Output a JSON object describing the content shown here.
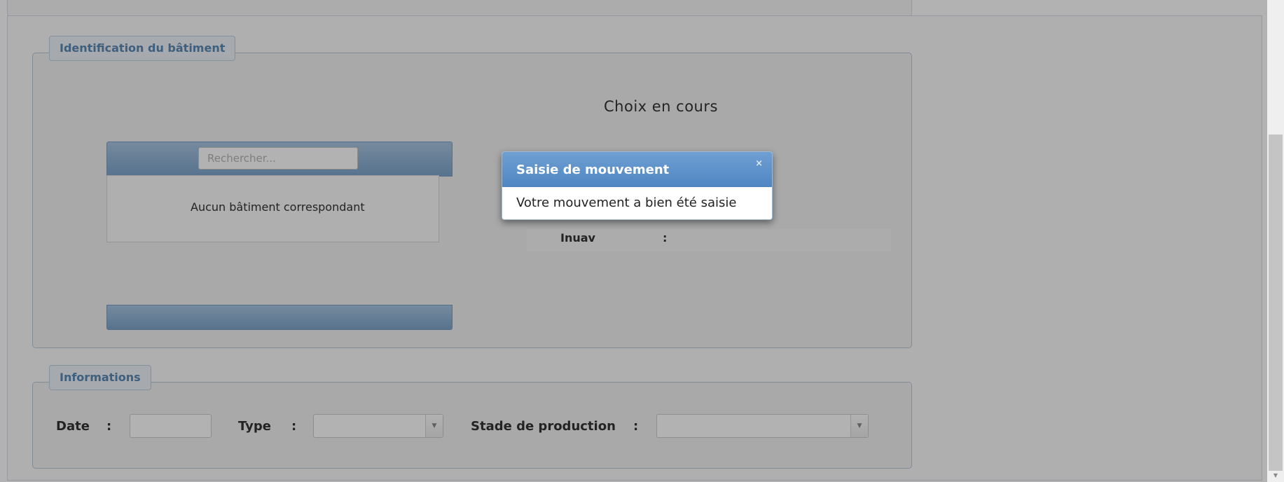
{
  "section_building": {
    "legend": "Identification du bâtiment",
    "search_placeholder": "Rechercher...",
    "empty_text": "Aucun bâtiment correspondant",
    "choice_title": "Choix en cours",
    "field_label": "Inuav",
    "field_separator": ":"
  },
  "section_info": {
    "legend": "Informations",
    "date_label": "Date",
    "type_label": "Type",
    "stage_label": "Stade de production",
    "separator": ":"
  },
  "dialog": {
    "title": "Saisie de mouvement",
    "close_symbol": "×",
    "message": "Votre mouvement a bien été saisie"
  },
  "icons": {
    "dropdown": "triangle-down",
    "close": "x-mark"
  }
}
